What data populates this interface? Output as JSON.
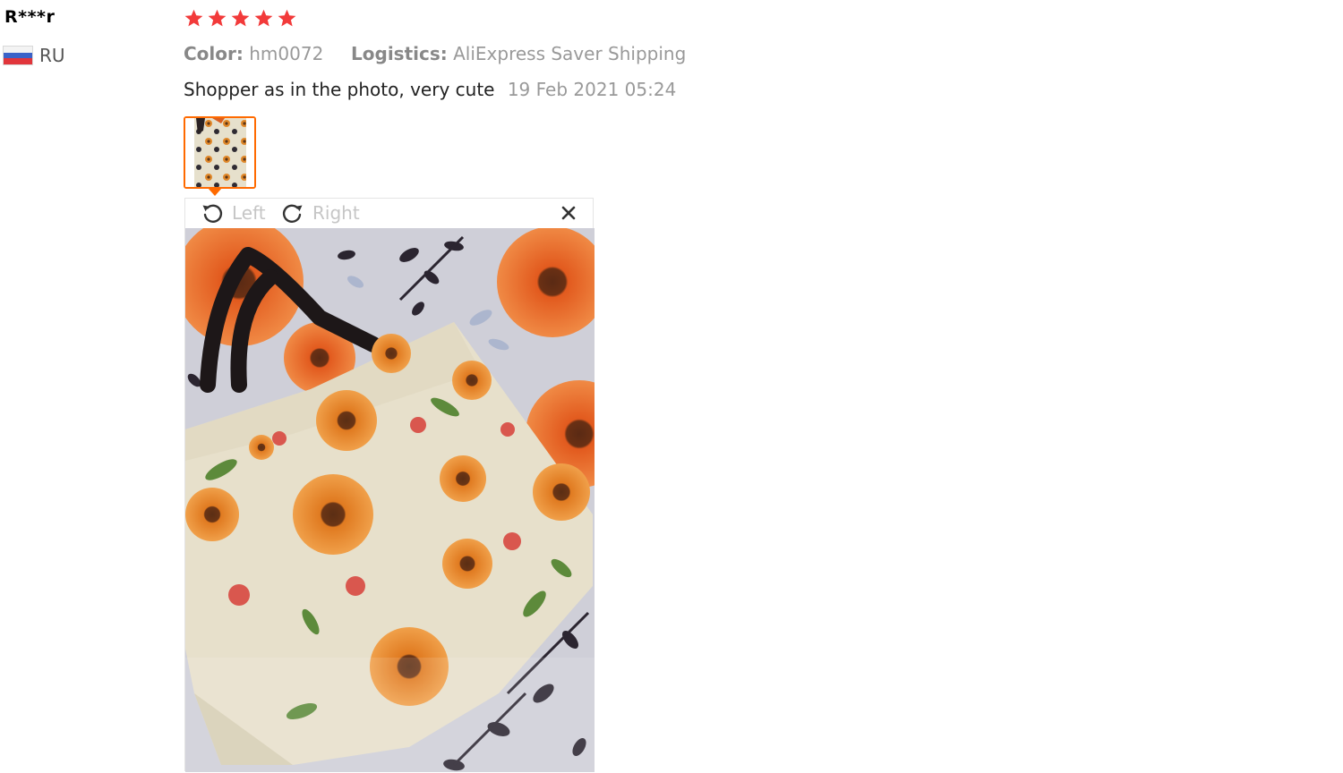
{
  "review": {
    "author": "R***r",
    "country": {
      "code": "RU",
      "flag_colors": [
        "#f3f3f3",
        "#3a62c8",
        "#e1353b"
      ]
    },
    "rating": 5,
    "rating_max": 5,
    "star_color": "#f23a3a",
    "attributes": [
      {
        "label": "Color:",
        "value": "hm0072"
      },
      {
        "label": "Logistics:",
        "value": "AliExpress Saver Shipping"
      }
    ],
    "text": "Shopper as in the photo, very cute",
    "date": "19 Feb 2021 05:24",
    "photos": [
      {
        "icon": "review-photo-thumbnail",
        "selected": true
      }
    ]
  },
  "viewer": {
    "rotate_left_label": "Left",
    "rotate_right_label": "Right",
    "rotate_left_icon": "rotate-left-icon",
    "rotate_right_icon": "rotate-right-icon",
    "close_icon": "close-icon",
    "accent_color": "#ff6a00"
  }
}
